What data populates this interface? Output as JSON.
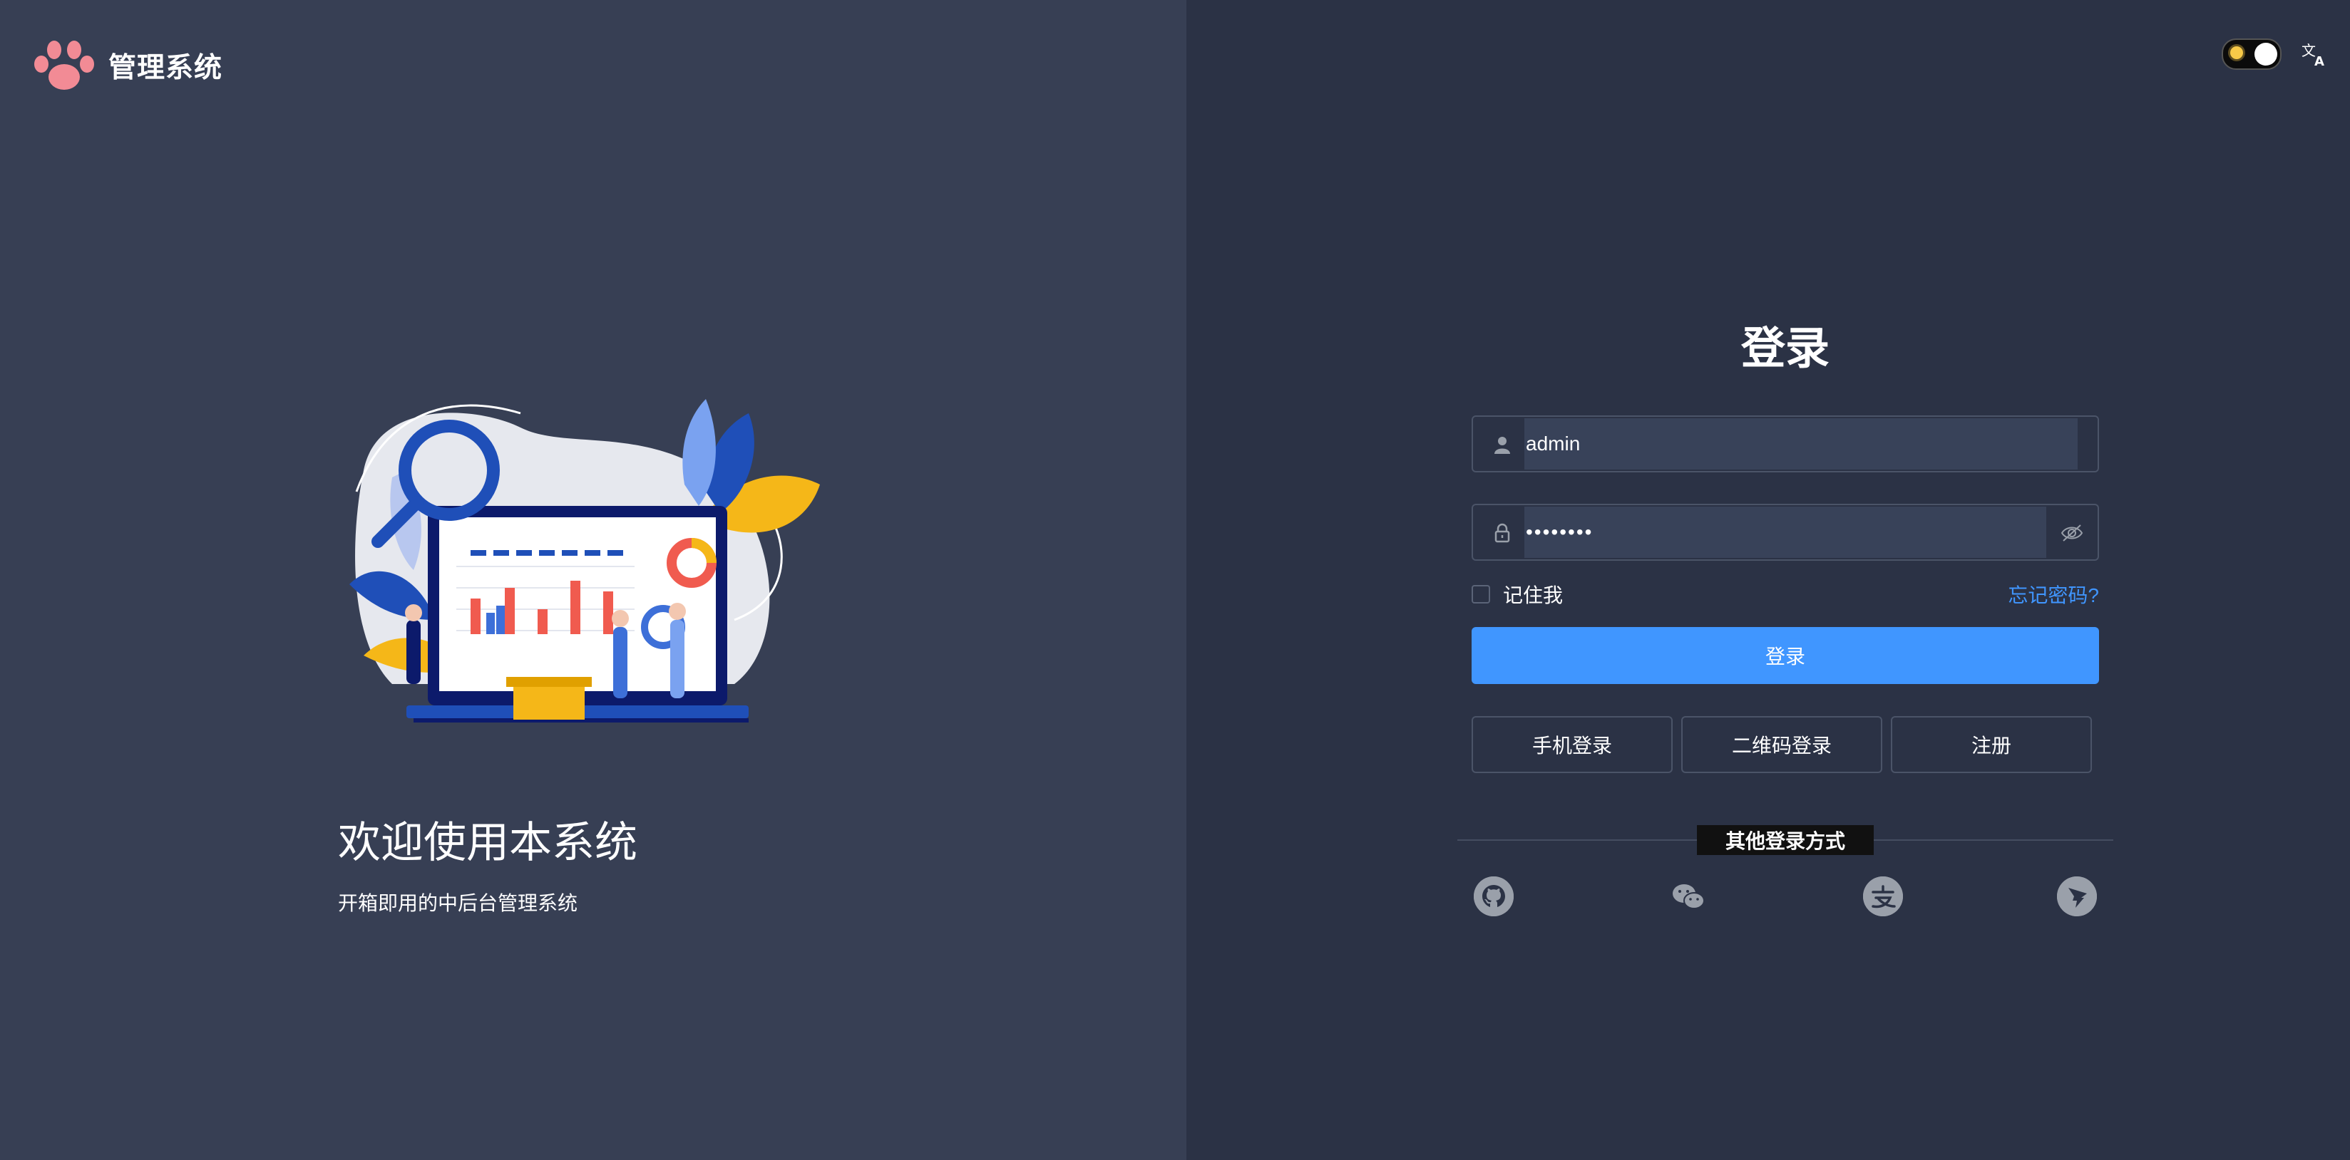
{
  "brand": {
    "title": "管理系统",
    "logo_icon": "paw-icon"
  },
  "welcome": {
    "title": "欢迎使用本系统",
    "subtitle": "开箱即用的中后台管理系统"
  },
  "topbar": {
    "theme_toggle": "sun-icon",
    "language": "translate-icon"
  },
  "login": {
    "title": "登录",
    "username": "admin",
    "password_mask": "••••••••",
    "remember_label": "记住我",
    "forgot_label": "忘记密码?",
    "submit_label": "登录",
    "alt_buttons": [
      "手机登录",
      "二维码登录",
      "注册"
    ],
    "other_label": "其他登录方式",
    "social_icons": [
      "github-icon",
      "wechat-icon",
      "alipay-icon",
      "dingtalk-icon"
    ]
  },
  "colors": {
    "accent": "#4096ff",
    "left_bg": "#373f54",
    "right_bg": "#2b3245"
  }
}
